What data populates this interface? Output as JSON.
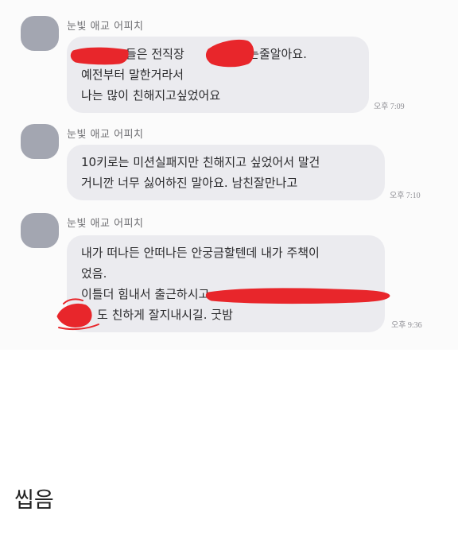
{
  "messages": [
    {
      "sender": "눈빛 애교 어피치",
      "lines": [
        "들은 전직장",
        "로 가는줄알아요.",
        "예전부터 말한거라서",
        "나는 많이 친해지고싶었어요"
      ],
      "time": "오후 7:09"
    },
    {
      "sender": "눈빛 애교 어피치",
      "lines": [
        "10키로는 미션실패지만 친해지고 싶었어서 말건",
        "거니깐 너무 싫어하진 말아요. 남친잘만나고"
      ],
      "time": "오후 7:10"
    },
    {
      "sender": "눈빛 애교 어피치",
      "lines": [
        "내가 떠나든 안떠나든 안궁금할텐데 내가 주책이",
        "었음.",
        "이틀더 힘내서 출근하시고",
        "도 친하게 잘지내시길. 굿밤"
      ],
      "time": "오후 9:36"
    }
  ],
  "caption": "씹음",
  "colors": {
    "bubble": "#ebebef",
    "avatar": "#a3a6b1",
    "redaction": "#e8262b"
  }
}
